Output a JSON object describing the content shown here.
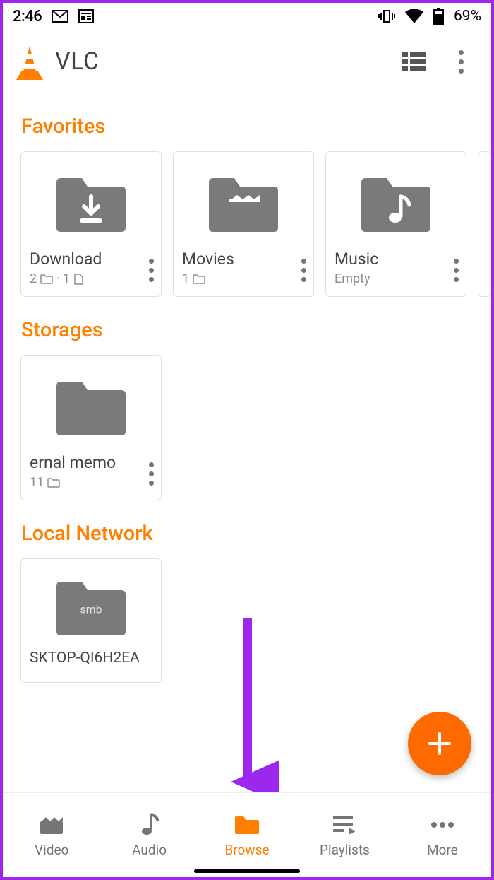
{
  "status": {
    "time": "2:46",
    "battery": "69%"
  },
  "app": {
    "title": "VLC"
  },
  "sections": {
    "favorites": {
      "title": "Favorites",
      "items": [
        {
          "name": "Download",
          "folders": "2",
          "files": "1"
        },
        {
          "name": "Movies",
          "folders": "1"
        },
        {
          "name": "Music",
          "empty": "Empty"
        }
      ]
    },
    "storages": {
      "title": "Storages",
      "items": [
        {
          "name": "ernal memo",
          "folders": "11"
        }
      ]
    },
    "local_network": {
      "title": "Local Network",
      "items": [
        {
          "name": "SKTOP-QI6H2EA",
          "proto": "smb"
        }
      ]
    }
  },
  "fab": {
    "symbol": "+"
  },
  "nav": {
    "items": [
      {
        "label": "Video"
      },
      {
        "label": "Audio"
      },
      {
        "label": "Browse",
        "active": true
      },
      {
        "label": "Playlists"
      },
      {
        "label": "More"
      }
    ]
  }
}
